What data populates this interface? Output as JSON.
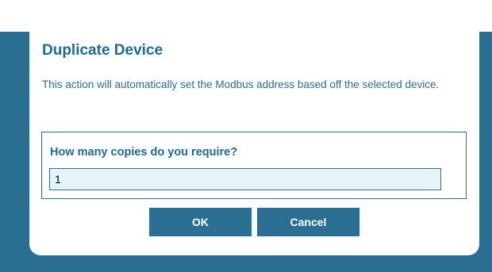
{
  "dialog": {
    "title": "Duplicate Device",
    "description": "This action will automatically set the Modbus address based off the selected device.",
    "prompt": {
      "label": "How many copies do you require?",
      "copies_value": "1"
    },
    "buttons": {
      "ok_label": "OK",
      "cancel_label": "Cancel"
    }
  },
  "colors": {
    "accent": "#1f6a93",
    "backdrop": "#2a6e92",
    "input_background": "#e6f3f8"
  }
}
